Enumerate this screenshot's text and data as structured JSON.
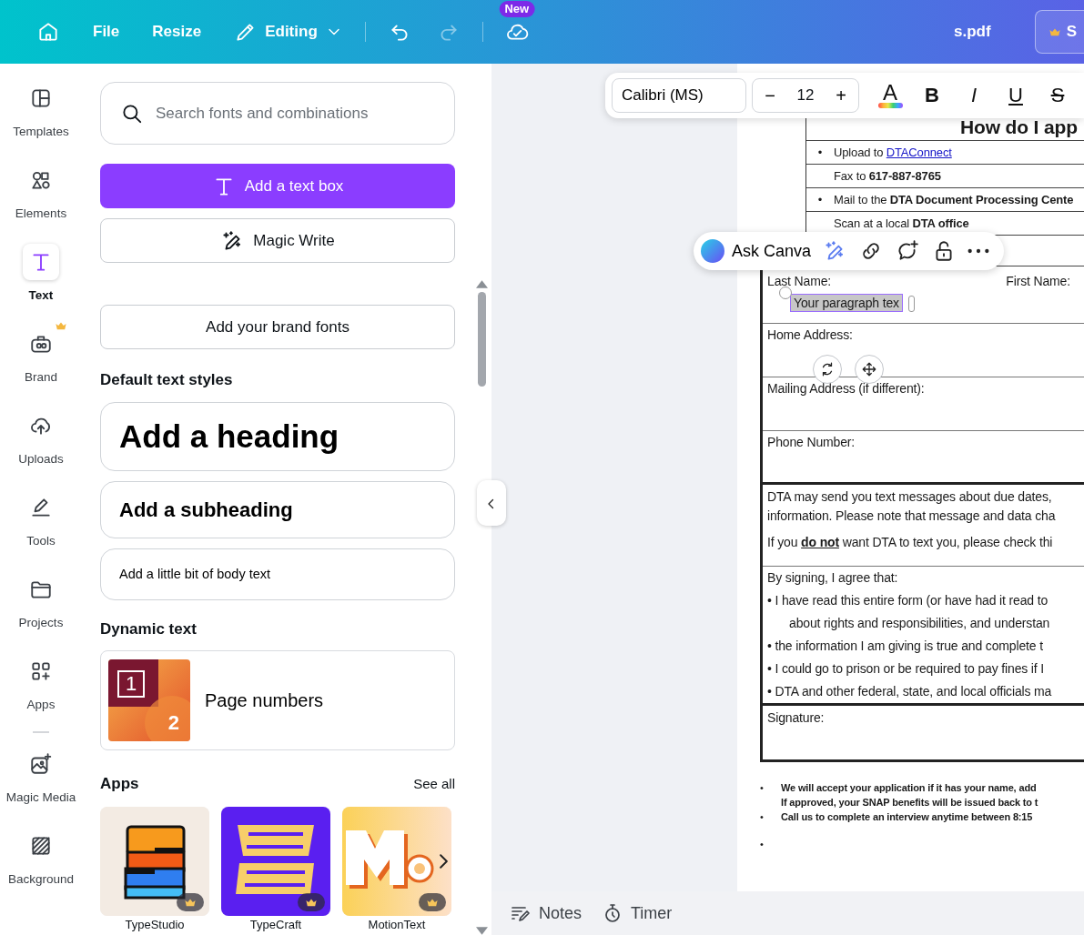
{
  "topbar": {
    "menu": [
      "File",
      "Resize"
    ],
    "mode": "Editing",
    "undo": {
      "disabled": false
    },
    "redo": {
      "disabled": true
    },
    "badge": "New",
    "file_name": "s.pdf",
    "share_label": "S"
  },
  "rail": [
    {
      "kind": "templates",
      "label": "Templates",
      "selected": false,
      "premium": false
    },
    {
      "kind": "elements",
      "label": "Elements",
      "selected": false,
      "premium": false
    },
    {
      "kind": "text",
      "label": "Text",
      "selected": true,
      "premium": false
    },
    {
      "kind": "brand",
      "label": "Brand",
      "selected": false,
      "premium": true
    },
    {
      "kind": "uploads",
      "label": "Uploads",
      "selected": false,
      "premium": false
    },
    {
      "kind": "tools",
      "label": "Tools",
      "selected": false,
      "premium": false
    },
    {
      "kind": "projects",
      "label": "Projects",
      "selected": false,
      "premium": false
    },
    {
      "kind": "apps",
      "label": "Apps",
      "selected": false,
      "premium": false
    },
    {
      "kind": "magic",
      "label": "Magic Media",
      "selected": false,
      "premium": false
    },
    {
      "kind": "background",
      "label": "Background",
      "selected": false,
      "premium": false
    }
  ],
  "panel": {
    "search": {
      "placeholder": "Search fonts and combinations"
    },
    "add_text_box": "Add a text box",
    "magic_write": "Magic Write",
    "brand_fonts": "Add your brand fonts",
    "styles_title": "Default text styles",
    "styles": [
      {
        "kind": "heading",
        "label": "Add a heading"
      },
      {
        "kind": "subheading",
        "label": "Add a subheading"
      },
      {
        "kind": "body",
        "label": "Add a little bit of body text"
      }
    ],
    "dynamic_title": "Dynamic text",
    "dynamic": {
      "label": "Page numbers",
      "digits": [
        "1",
        "2"
      ]
    },
    "apps_title": "Apps",
    "see_all": "See all",
    "apps": [
      {
        "kind": "studio",
        "label": "TypeStudio",
        "premium": true
      },
      {
        "kind": "craft",
        "label": "TypeCraft",
        "premium": true
      },
      {
        "kind": "motion",
        "label": "MotionText",
        "premium": true
      }
    ]
  },
  "format_toolbar": {
    "font": "Calibri (MS)",
    "minus": "−",
    "size": "12",
    "plus": "+",
    "color_label": "A",
    "styles": [
      {
        "kind": "bold",
        "label": "B"
      },
      {
        "kind": "italic",
        "label": "I"
      },
      {
        "kind": "underline",
        "label": "U"
      },
      {
        "kind": "strike",
        "label": "S"
      }
    ]
  },
  "ask_canva": {
    "label": "Ask Canva"
  },
  "document": {
    "heading": "How do I app",
    "methods": [
      {
        "marker": "•",
        "text": "Upload to",
        "link": "DTAConnect"
      },
      {
        "text": "Fax to **617-887-8765**"
      },
      {
        "marker": "•",
        "text": "Mail to the **DTA Document Processing Cente**"
      },
      {
        "text": "Scan at a local **DTA office**"
      }
    ],
    "name_labels": [
      "Last Name:",
      "First Name:"
    ],
    "text_box": {
      "value": "Your paragraph tex",
      "selected": true
    },
    "fields": [
      "Home Address:",
      "Mailing Address (if different):",
      "Phone Number:"
    ],
    "consent": [
      "DTA may send you text messages about due dates,",
      "information. Please note that message and data cha",
      "If you **do not** want DTA to text you, please check thi"
    ],
    "agreement_title": "By signing, I agree that:",
    "agreement": [
      {
        "marker": "•",
        "text": "I have read this entire form (or have had it read to"
      },
      {
        "text": "about rights and responsibilities, and understan"
      },
      {
        "marker": "•",
        "text": "the information I am giving is true and complete t"
      },
      {
        "marker": "•",
        "text": "I could go to prison or be required to pay fines if I"
      },
      {
        "marker": "•",
        "text": "DTA and other federal, state, and local officials ma"
      }
    ],
    "signature": "Signature:",
    "footer": [
      {
        "marker": "•",
        "text": "We will accept your application if it has your name, add"
      },
      {
        "text": "If approved, your SNAP benefits will be issued back to t"
      },
      {
        "marker": "•",
        "text": "Call us to complete an interview anytime between 8:15"
      },
      {
        "marker": "•"
      }
    ]
  },
  "bottom_bar": [
    {
      "kind": "notes",
      "label": "Notes"
    },
    {
      "kind": "timer",
      "label": "Timer"
    }
  ]
}
